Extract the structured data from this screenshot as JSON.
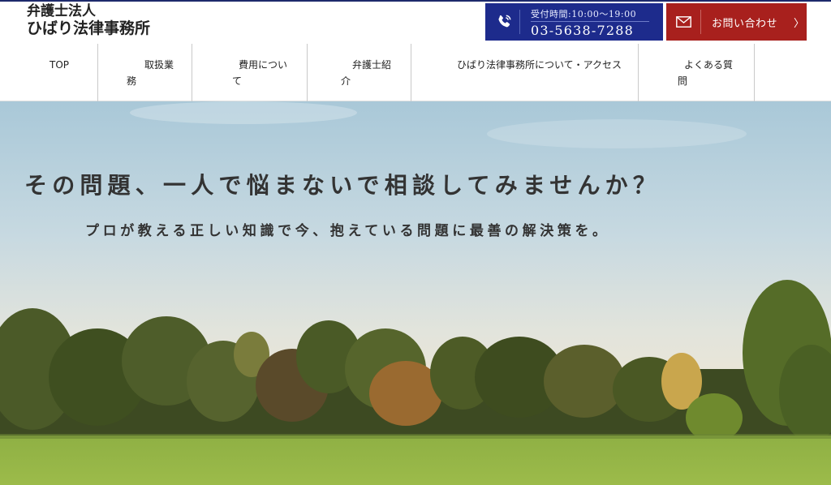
{
  "header": {
    "logo_line1": "弁護士法人",
    "logo_line2": "ひばり法律事務所",
    "phone": {
      "hours": "受付時間:10:00～19:00",
      "number": "03-5638-7288",
      "icon": "phone-icon",
      "bg_color": "#1d2b8c"
    },
    "contact": {
      "label": "お問い合わせ",
      "chevron": "〉",
      "icon": "mail-icon",
      "bg_color": "#a8201d"
    }
  },
  "nav": {
    "items": [
      {
        "label": "TOP"
      },
      {
        "label": "取扱業務"
      },
      {
        "label": "費用について"
      },
      {
        "label": "弁護士紹介"
      },
      {
        "label": "ひばり法律事務所について・アクセス"
      },
      {
        "label": "よくある質問"
      }
    ]
  },
  "hero": {
    "headline": "その問題、一人で悩まないで相談してみませんか？",
    "subheadline": "プロが教える正しい知識で今、抱えている問題に最善の解決策を。"
  }
}
